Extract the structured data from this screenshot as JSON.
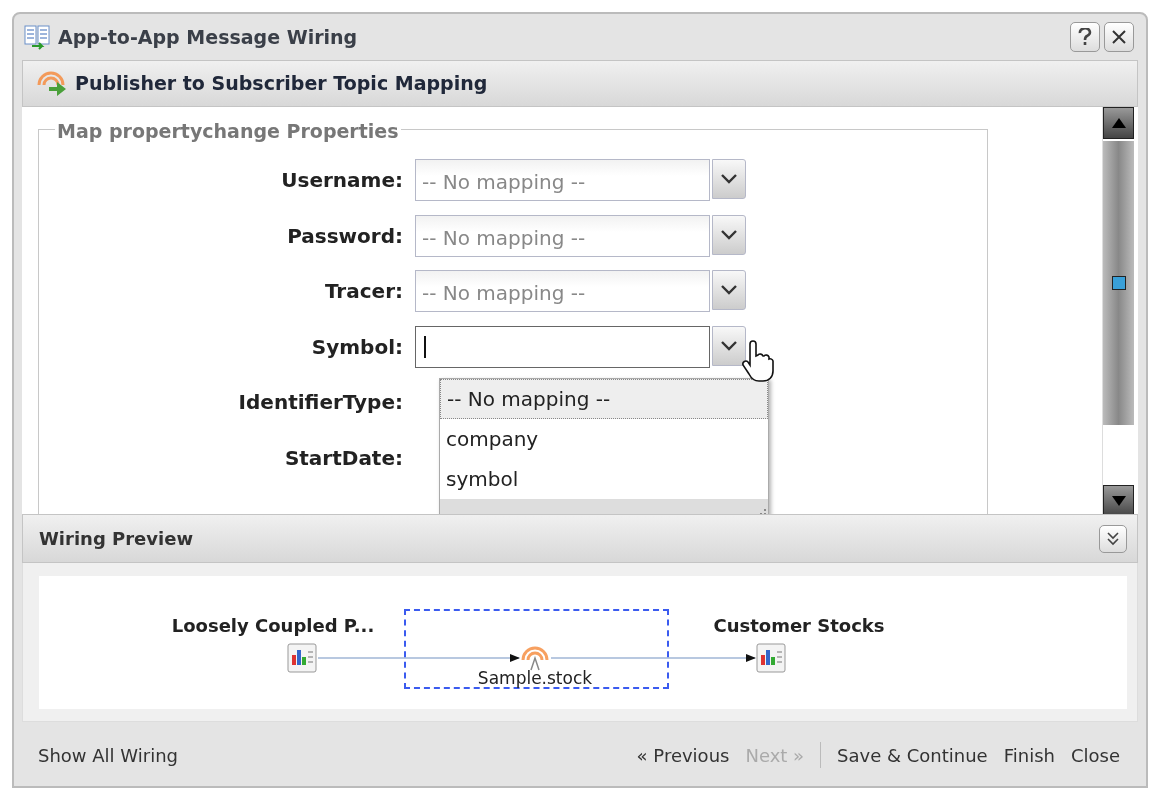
{
  "window": {
    "title": "App-to-App Message Wiring"
  },
  "panel": {
    "title": "Publisher to Subscriber Topic Mapping"
  },
  "fieldset": {
    "legend": "Map propertychange Properties",
    "fields": [
      {
        "label": "Username:",
        "kind": "combo",
        "placeholder": "-- No mapping --",
        "focused": false
      },
      {
        "label": "Password:",
        "kind": "combo",
        "placeholder": "-- No mapping --",
        "focused": false
      },
      {
        "label": "Tracer:",
        "kind": "combo",
        "placeholder": "-- No mapping --",
        "focused": false
      },
      {
        "label": "Symbol:",
        "kind": "combo",
        "focused": true
      },
      {
        "label": "IdentifierType:",
        "kind": "covered"
      },
      {
        "label": "StartDate:",
        "kind": "covered"
      }
    ]
  },
  "dropdown": {
    "options": [
      {
        "label": "-- No mapping --",
        "selected": true
      },
      {
        "label": "company",
        "selected": false
      },
      {
        "label": "symbol",
        "selected": false
      }
    ]
  },
  "preview": {
    "title": "Wiring Preview",
    "nodes": [
      {
        "label": "Loosely Coupled P...",
        "kind": "app",
        "selected": false
      },
      {
        "label": "Sample.stock",
        "kind": "topic",
        "selected": true
      },
      {
        "label": "Customer Stocks",
        "kind": "app",
        "selected": false
      }
    ]
  },
  "footer": {
    "link": "Show All Wiring",
    "buttons": [
      {
        "label": "« Previous",
        "disabled": false,
        "separator_before": false
      },
      {
        "label": "Next »",
        "disabled": true,
        "separator_before": false
      },
      {
        "label": "Save & Continue",
        "disabled": false,
        "separator_before": true
      },
      {
        "label": "Finish",
        "disabled": false,
        "separator_before": false
      },
      {
        "label": "Close",
        "disabled": false,
        "separator_before": false
      }
    ]
  }
}
